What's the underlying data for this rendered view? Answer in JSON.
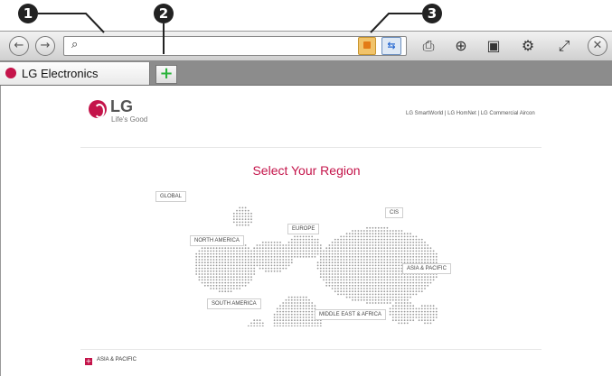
{
  "callouts": [
    "1",
    "2",
    "3"
  ],
  "browser": {
    "back_glyph": "←",
    "forward_glyph": "→",
    "search_glyph": "⌕",
    "url_value": "",
    "tab_title": "LG Electronics",
    "new_tab_glyph": "+",
    "close_glyph": "✕",
    "mic_glyph": "🎤",
    "zoom_glyph": "⊕",
    "tv_glyph": "📺",
    "settings_glyph": "⚙",
    "fullscreen_glyph": "⛶",
    "icons": [
      "back-icon",
      "forward-icon",
      "search-icon",
      "bookmark-icon",
      "sync-icon",
      "microphone-icon",
      "zoom-in-icon",
      "tv-icon",
      "globe-settings-icon",
      "fullscreen-icon",
      "close-icon"
    ]
  },
  "page": {
    "logo_text": "LG",
    "tagline": "Life's Good",
    "top_links": "LG SmartWorld | LG HomNet | LG Commercial Aircon",
    "heading": "Select Your Region",
    "regions": {
      "global": "GLOBAL",
      "north_america": "NORTH AMERICA",
      "europe": "EUROPE",
      "cis": "CIS",
      "asia_pacific": "ASIA & PACIFIC",
      "south_america": "SOUTH AMERICA",
      "middle_east_africa": "MIDDLE EAST & AFRICA"
    },
    "list_item": "ASIA & PACIFIC",
    "list_marker": "+"
  },
  "colors": {
    "brand": "#c4144a",
    "map_dots": "#9a9a9a",
    "new_tab_plus": "#2bb33c"
  }
}
